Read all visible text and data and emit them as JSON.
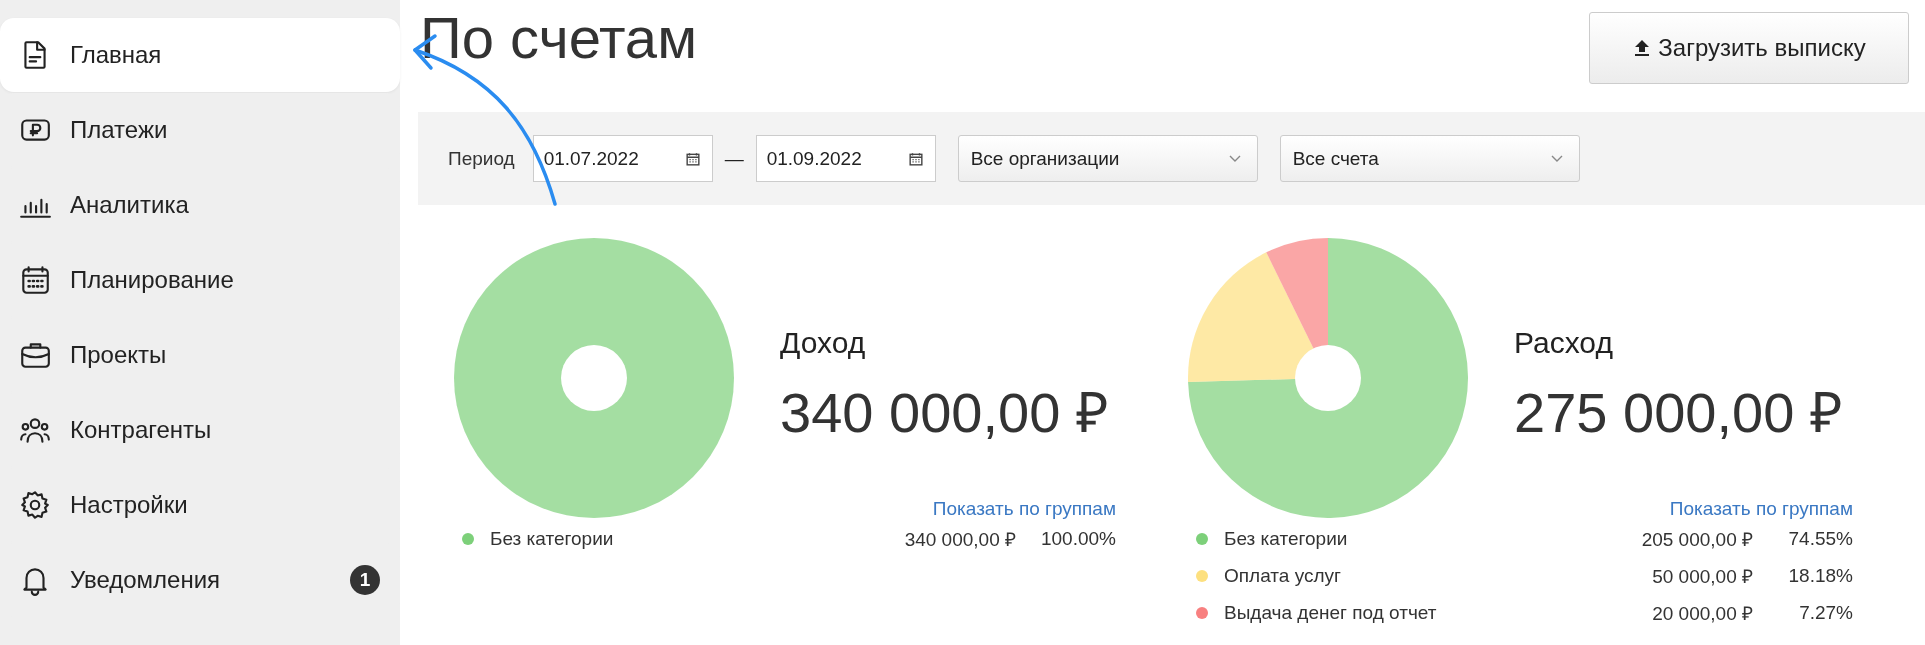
{
  "sidebar": {
    "items": [
      {
        "label": "Главная",
        "selected": true
      },
      {
        "label": "Платежи",
        "selected": false
      },
      {
        "label": "Аналитика",
        "selected": false
      },
      {
        "label": "Планирование",
        "selected": false
      },
      {
        "label": "Проекты",
        "selected": false
      },
      {
        "label": "Контрагенты",
        "selected": false
      },
      {
        "label": "Настройки",
        "selected": false
      },
      {
        "label": "Уведомления",
        "selected": false,
        "badge": "1"
      }
    ]
  },
  "page_title": "По счетам",
  "upload_button": "Загрузить выписку",
  "filters": {
    "period_label": "Период",
    "date_from": "01.07.2022",
    "date_separator": "—",
    "date_to": "01.09.2022",
    "organization": "Все организации",
    "account": "Все счета"
  },
  "panels": [
    {
      "title": "Доход",
      "amount": "340 000,00 ₽",
      "link": "Показать по группам",
      "chart_data": {
        "type": "donut",
        "categories": [
          "Без категории"
        ],
        "values": [
          100
        ]
      },
      "legend": [
        {
          "amount": "340 000,00 ₽",
          "percent": "100.00%",
          "color": "#7dd07a"
        }
      ]
    },
    {
      "title": "Расход",
      "amount": "275 000,00 ₽",
      "link": "Показать по группам",
      "chart_data": {
        "type": "donut",
        "categories": [
          "Без категории",
          "Оплата услуг",
          "Выдача денег под отчет"
        ],
        "values": [
          74.55,
          18.18,
          7.27
        ]
      },
      "legend": [
        {
          "amount": "205 000,00 ₽",
          "percent": "74.55%",
          "color": "#7dd07a"
        },
        {
          "amount": "50 000,00 ₽",
          "percent": "18.18%",
          "color": "#fde07f"
        },
        {
          "amount": "20 000,00 ₽",
          "percent": "7.27%",
          "color": "#f88080"
        }
      ]
    }
  ]
}
